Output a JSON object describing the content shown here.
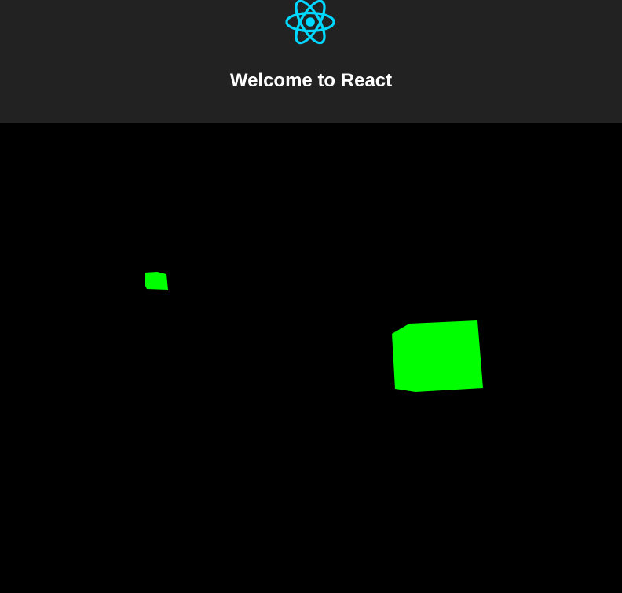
{
  "header": {
    "title": "Welcome to React",
    "background": "#222222",
    "logo_icon": "react-atom-icon",
    "logo_color": "#00d8ff",
    "title_color": "#ffffff"
  },
  "scene": {
    "background": "#000000",
    "object_color": "#00ff00",
    "objects": [
      {
        "name": "small-green-cube"
      },
      {
        "name": "large-green-cube"
      }
    ]
  }
}
